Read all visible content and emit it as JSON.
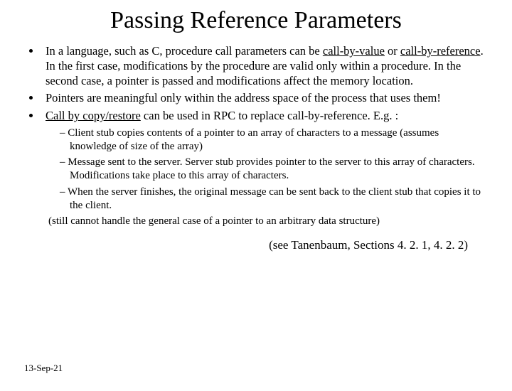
{
  "title": "Passing Reference Parameters",
  "bullets": {
    "b1": {
      "pre": "In a language, such as C, procedure call parameters can be ",
      "u1": "call-by-value",
      "mid1": " or ",
      "u2": "call-by-reference",
      "post": ". In the first case, modifications by the procedure are valid only within a procedure. In the second case, a pointer is passed and modifications affect the memory location."
    },
    "b2": "Pointers are meaningful only within the address space of the process that uses them!",
    "b3": {
      "u": "Call by copy/restore",
      "post": " can be used in RPC to replace call-by-reference. E.g. :"
    }
  },
  "sub": {
    "s1": "Client stub copies contents of a pointer to an array of characters to a message (assumes knowledge of size of the array)",
    "s2": "Message sent to the server. Server stub provides pointer to the server to this array of characters. Modifications take place to this array of characters.",
    "s3": "When the server finishes, the original message can be sent back to the client stub that copies it to the client."
  },
  "paren_note": "(still cannot handle the general case of a pointer to an arbitrary data structure)",
  "reference": "(see Tanenbaum, Sections 4. 2. 1, 4. 2. 2)",
  "date": "13-Sep-21"
}
